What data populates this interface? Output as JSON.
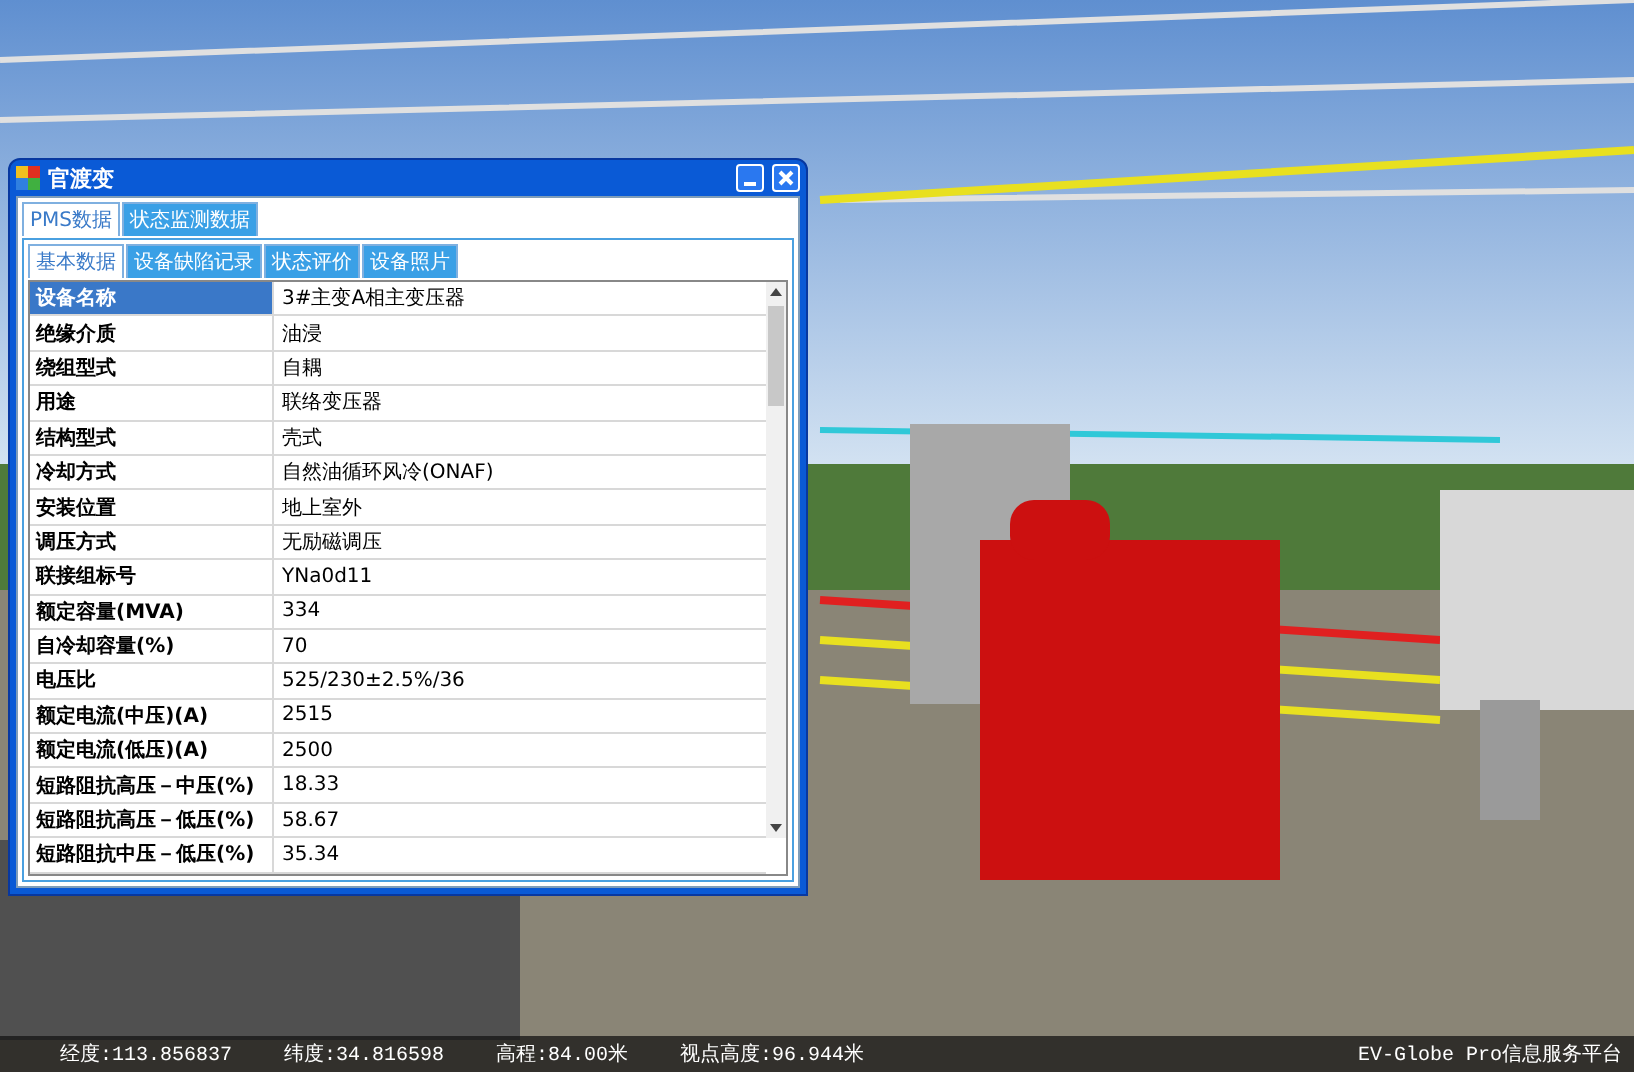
{
  "window": {
    "title": "官渡变"
  },
  "tabs": [
    {
      "label": "PMS数据",
      "selected": true
    },
    {
      "label": "状态监测数据",
      "selected": false
    }
  ],
  "subtabs": [
    {
      "label": "基本数据",
      "selected": true
    },
    {
      "label": "设备缺陷记录",
      "selected": false
    },
    {
      "label": "状态评价",
      "selected": false
    },
    {
      "label": "设备照片",
      "selected": false
    }
  ],
  "table": {
    "rows": [
      {
        "label": "设备名称",
        "value": "3#主变A相主变压器",
        "selected": true
      },
      {
        "label": "绝缘介质",
        "value": "油浸",
        "selected": false
      },
      {
        "label": "绕组型式",
        "value": "自耦",
        "selected": false
      },
      {
        "label": "用途",
        "value": "联络变压器",
        "selected": false
      },
      {
        "label": "结构型式",
        "value": "壳式",
        "selected": false
      },
      {
        "label": "冷却方式",
        "value": "自然油循环风冷(ONAF)",
        "selected": false
      },
      {
        "label": "安装位置",
        "value": "地上室外",
        "selected": false
      },
      {
        "label": "调压方式",
        "value": "无励磁调压",
        "selected": false
      },
      {
        "label": "联接组标号",
        "value": "YNa0d11",
        "selected": false
      },
      {
        "label": "额定容量(MVA)",
        "value": "334",
        "selected": false
      },
      {
        "label": "自冷却容量(%)",
        "value": "70",
        "selected": false
      },
      {
        "label": "电压比",
        "value": "525/230±2.5%/36",
        "selected": false
      },
      {
        "label": "额定电流(中压)(A)",
        "value": "2515",
        "selected": false
      },
      {
        "label": "额定电流(低压)(A)",
        "value": "2500",
        "selected": false
      },
      {
        "label": "短路阻抗高压－中压(%)",
        "value": "18.33",
        "selected": false
      },
      {
        "label": "短路阻抗高压－低压(%)",
        "value": "58.67",
        "selected": false
      },
      {
        "label": "短路阻抗中压－低压(%)",
        "value": "35.34",
        "selected": false
      }
    ]
  },
  "status_bar": {
    "items": [
      "经度:113.856837",
      "纬度:34.816598",
      "高程:84.00米",
      "视点高度:96.944米"
    ],
    "platform": "EV-Globe Pro信息服务平台"
  }
}
